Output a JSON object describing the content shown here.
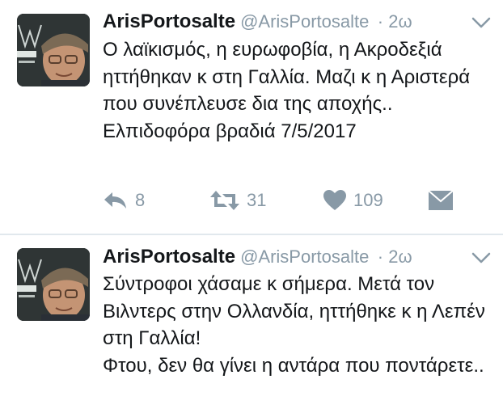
{
  "tweets": [
    {
      "name": "ArisPortosalte",
      "handle": "@ArisPortosalte",
      "time": "· 2ω",
      "text": "Ο λαϊκισμός, η ευρωφοβία, η Ακροδεξιά ηττήθηκαν κ στη Γαλλία. Μαζι κ η Αριστερά που συνέπλευσε δια της αποχής..\nΕλπιδοφόρα βραδιά 7/5/2017",
      "reply_count": "8",
      "retweet_count": "31",
      "like_count": "109"
    },
    {
      "name": "ArisPortosalte",
      "handle": "@ArisPortosalte",
      "time": "· 2ω",
      "text": "Σύντροφοι χάσαμε κ σήμερα. Μετά τον Βιλντερς στην Ολλανδία, ηττήθηκε κ η Λεπέν στη Γαλλία!\nΦτου, δεν θα γίνει η αντάρα που ποντάρετε.."
    }
  ],
  "colors": {
    "text": "#14171a",
    "muted": "#8899a6",
    "divider": "#e1e8ed"
  },
  "icons": [
    "reply-icon",
    "retweet-icon",
    "like-icon",
    "direct-message-icon",
    "chevron-down-icon",
    "avatar"
  ]
}
